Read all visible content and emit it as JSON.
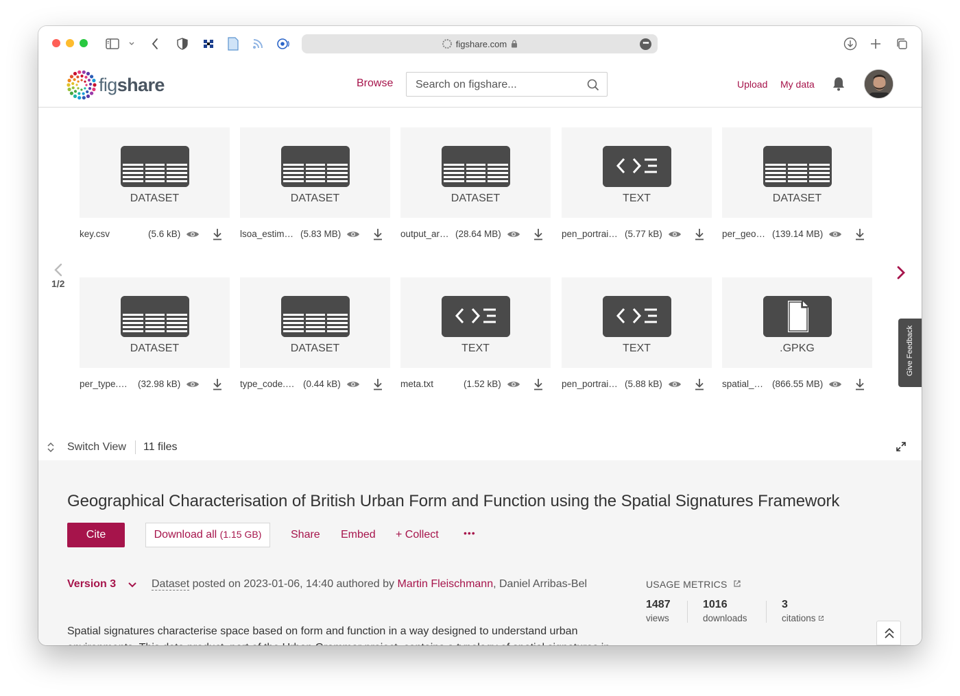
{
  "browser": {
    "url": "figshare.com"
  },
  "header": {
    "logo_text_a": "fig",
    "logo_text_b": "share",
    "browse": "Browse",
    "search_placeholder": "Search on figshare...",
    "upload": "Upload",
    "my_data": "My data"
  },
  "files": [
    {
      "type": "DATASET",
      "icon": "table-icon",
      "name": "key.csv",
      "size": "(5.6 kB)"
    },
    {
      "type": "DATASET",
      "icon": "table-icon",
      "name": "lsoa_estim…",
      "size": "(5.83 MB)"
    },
    {
      "type": "DATASET",
      "icon": "table-icon",
      "name": "output_ar…",
      "size": "(28.64 MB)"
    },
    {
      "type": "TEXT",
      "icon": "code-icon",
      "name": "pen_portrai…",
      "size": "(5.77 kB)"
    },
    {
      "type": "DATASET",
      "icon": "table-icon",
      "name": "per_geo…",
      "size": "(139.14 MB)"
    },
    {
      "type": "DATASET",
      "icon": "table-icon",
      "name": "per_type.…",
      "size": "(32.98 kB)"
    },
    {
      "type": "DATASET",
      "icon": "table-icon",
      "name": "type_code.…",
      "size": "(0.44 kB)"
    },
    {
      "type": "TEXT",
      "icon": "code-icon",
      "name": "meta.txt",
      "size": "(1.52 kB)"
    },
    {
      "type": "TEXT",
      "icon": "code-icon",
      "name": "pen_portrai…",
      "size": "(5.88 kB)"
    },
    {
      "type": ".GPKG",
      "icon": "file-icon",
      "name": "spatial_…",
      "size": "(866.55 MB)"
    }
  ],
  "pager": {
    "label": "1/2"
  },
  "feedback": "Give Feedback",
  "switch_bar": {
    "switch_view": "Switch View",
    "file_count": "11 files"
  },
  "item": {
    "title": "Geographical Characterisation of British Urban Form and Function using the Spatial Signatures Framework",
    "cite": "Cite",
    "download_all": "Download all",
    "download_size": "(1.15 GB)",
    "share": "Share",
    "embed": "Embed",
    "collect": "+ Collect",
    "more": "•••",
    "version": "Version 3",
    "type_word": "Dataset",
    "posted_text": " posted on 2023-01-06, 14:40 authored by ",
    "author_1": "Martin Fleischmann",
    "author_sep": ", ",
    "author_2": "Daniel Arribas-Bel",
    "description": "Spatial signatures characterise space based on form and function in a way designed to understand urban environments. This data product, part of the Urban Grammar project, contains a typology of spatial signatures in"
  },
  "metrics": {
    "title": "USAGE METRICS",
    "views": "1487",
    "views_label": "views",
    "downloads": "1016",
    "downloads_label": "downloads",
    "citations": "3",
    "citations_label": "citations"
  },
  "colors": {
    "accent": "#a6144b",
    "badge": "#4a4a4a",
    "card": "#f5f5f5"
  }
}
